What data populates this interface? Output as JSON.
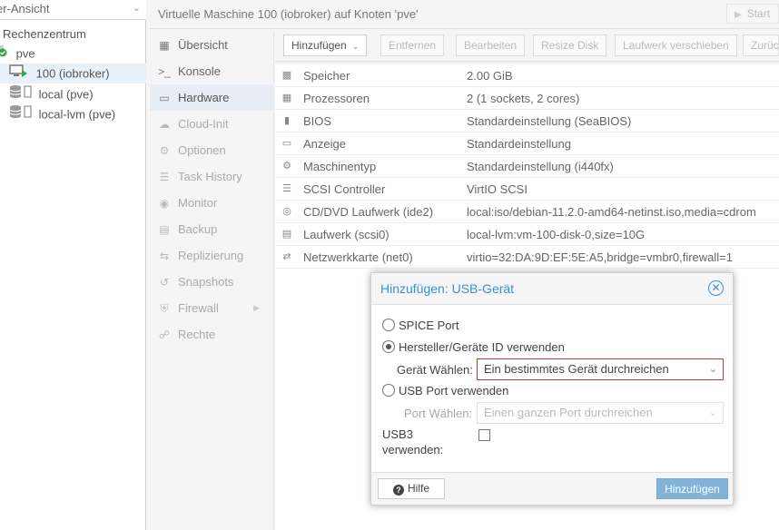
{
  "tree": {
    "view_label": "er-Ansicht",
    "datacenter": "Rechenzentrum",
    "node": "pve",
    "vm": "100 (iobroker)",
    "storage_local": "local (pve)",
    "storage_lvm": "local-lvm (pve)"
  },
  "header": {
    "title": "Virtuelle Maschine 100 (iobroker) auf Knoten 'pve'",
    "start_label": "Start"
  },
  "nav": [
    {
      "label": "Übersicht"
    },
    {
      "label": "Konsole"
    },
    {
      "label": "Hardware"
    },
    {
      "label": "Cloud-Init"
    },
    {
      "label": "Optionen"
    },
    {
      "label": "Task History"
    },
    {
      "label": "Monitor"
    },
    {
      "label": "Backup"
    },
    {
      "label": "Replizierung"
    },
    {
      "label": "Snapshots"
    },
    {
      "label": "Firewall"
    },
    {
      "label": "Rechte"
    }
  ],
  "toolbar": {
    "add": "Hinzufügen",
    "remove": "Entfernen",
    "edit": "Bearbeiten",
    "resize": "Resize Disk",
    "move": "Laufwerk verschieben",
    "revert": "Zurüc"
  },
  "hardware": [
    {
      "name": "Speicher",
      "value": "2.00 GiB",
      "icon": "memory-icon"
    },
    {
      "name": "Prozessoren",
      "value": "2 (1 sockets, 2 cores)",
      "icon": "cpu-icon"
    },
    {
      "name": "BIOS",
      "value": "Standardeinstellung (SeaBIOS)",
      "icon": "bios-icon"
    },
    {
      "name": "Anzeige",
      "value": "Standardeinstellung",
      "icon": "display-icon"
    },
    {
      "name": "Maschinentyp",
      "value": "Standardeinstellung (i440fx)",
      "icon": "machine-icon"
    },
    {
      "name": "SCSI Controller",
      "value": "VirtIO SCSI",
      "icon": "database-icon"
    },
    {
      "name": "CD/DVD Laufwerk (ide2)",
      "value": "local:iso/debian-11.2.0-amd64-netinst.iso,media=cdrom",
      "icon": "cdrom-icon"
    },
    {
      "name": "Laufwerk (scsi0)",
      "value": "local-lvm:vm-100-disk-0,size=10G",
      "icon": "harddisk-icon"
    },
    {
      "name": "Netzwerkkarte (net0)",
      "value": "virtio=32:DA:9D:EF:5E:A5,bridge=vmbr0,firewall=1",
      "icon": "network-icon"
    }
  ],
  "dialog": {
    "title": "Hinzufügen: USB-Gerät",
    "opt_spice": "SPICE Port",
    "opt_vendor": "Hersteller/Geräte ID verwenden",
    "device_label": "Gerät Wählen:",
    "device_value": "Ein bestimmtes Gerät durchreichen",
    "opt_port": "USB Port verwenden",
    "port_label": "Port Wählen:",
    "port_value": "Einen ganzen Port durchreichen",
    "usb3_label_1": "USB3",
    "usb3_label_2": "verwenden:",
    "help": "Hilfe",
    "submit": "Hinzufügen"
  },
  "colors": {
    "accent": "#3892d3",
    "invalid": "#c0392b",
    "submit_disabled": "#82b4da"
  }
}
